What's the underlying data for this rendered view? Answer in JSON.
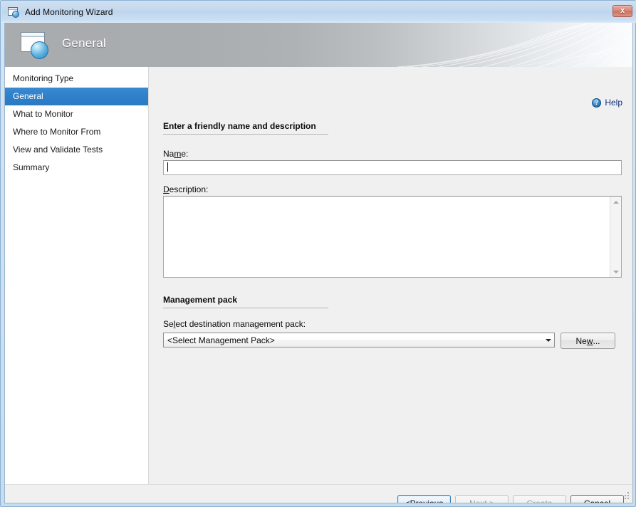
{
  "window": {
    "title": "Add Monitoring Wizard",
    "icon": "wizard-window-orb-icon",
    "close_label": "x"
  },
  "banner": {
    "title": "General",
    "icon": "wizard-window-orb-icon"
  },
  "sidebar": {
    "items": [
      {
        "label": "Monitoring Type",
        "active": false
      },
      {
        "label": "General",
        "active": true
      },
      {
        "label": "What to Monitor",
        "active": false
      },
      {
        "label": "Where to Monitor From",
        "active": false
      },
      {
        "label": "View and Validate Tests",
        "active": false
      },
      {
        "label": "Summary",
        "active": false
      }
    ]
  },
  "content": {
    "help": {
      "label": "Help",
      "icon": "help-question-icon"
    },
    "section_general": {
      "heading": "Enter a friendly name and description",
      "name_label_pre": "Na",
      "name_label_acc": "m",
      "name_label_post": "e:",
      "name_value": "",
      "description_label_acc": "D",
      "description_label_post": "escription:",
      "description_value": ""
    },
    "section_mp": {
      "heading": "Management pack",
      "select_label_pre": "Se",
      "select_label_acc": "l",
      "select_label_post": "ect destination management pack:",
      "combo_value": "<Select Management Pack>",
      "new_label_pre": "Ne",
      "new_label_acc": "w",
      "new_label_post": "..."
    }
  },
  "footer": {
    "buttons": [
      {
        "label_pre": "< ",
        "label_acc": "P",
        "label_post": "revious",
        "state": "focused"
      },
      {
        "label_pre": "",
        "label_acc": "N",
        "label_post": "ext >",
        "state": "disabled"
      },
      {
        "label_pre": "C",
        "label_acc": "r",
        "label_post": "eate",
        "state": "disabled"
      },
      {
        "label_pre": "",
        "label_acc": "C",
        "label_post": "ancel",
        "state": "strong"
      }
    ]
  },
  "colors": {
    "accent_selection": "#2f7fc9",
    "help_link": "#10307a",
    "content_bg": "#f0f0f0",
    "sidebar_bg": "#ffffff",
    "close_button": "#d98878"
  }
}
